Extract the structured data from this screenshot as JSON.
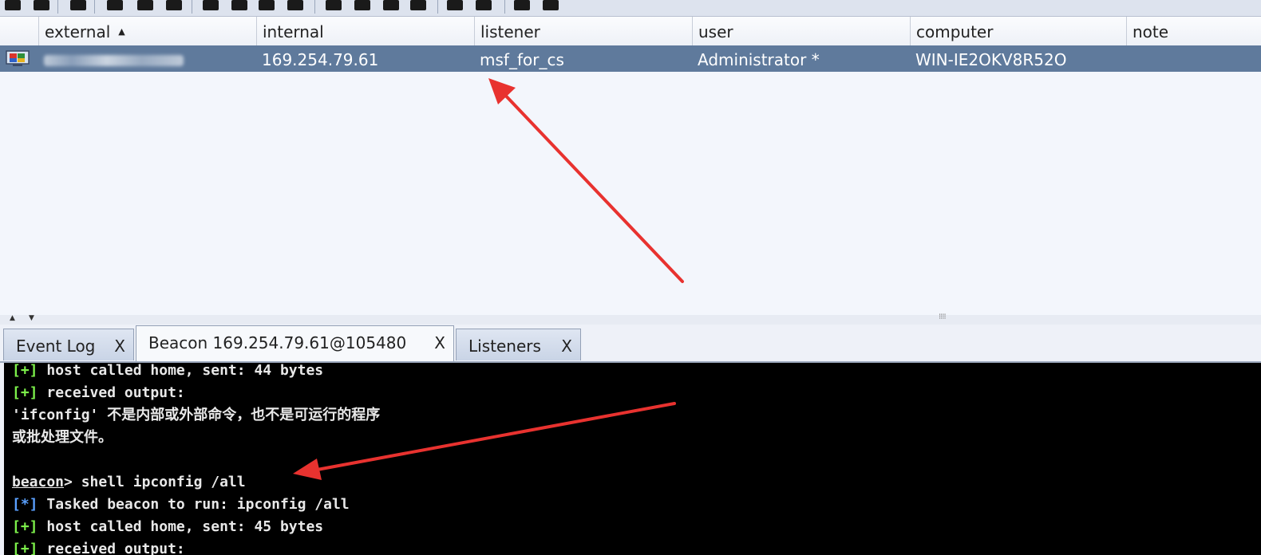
{
  "table": {
    "columns": [
      "external",
      "internal",
      "listener",
      "user",
      "computer",
      "note"
    ],
    "sort_indicator": "▲",
    "row": {
      "internal": "169.254.79.61",
      "listener": "msf_for_cs",
      "user": "Administrator *",
      "computer": "WIN-IE2OKV8R52O",
      "note": ""
    }
  },
  "divider": {
    "up": "▲",
    "down": "▼",
    "grip": "⁝⁝⁝⁝"
  },
  "tabs": [
    {
      "label": "Event Log",
      "close": "X"
    },
    {
      "label": "Beacon 169.254.79.61@105480",
      "close": "X"
    },
    {
      "label": "Listeners",
      "close": "X"
    }
  ],
  "console": {
    "l1": {
      "tag": "[+]",
      "text": " host called home, sent: 44 bytes"
    },
    "l2": {
      "tag": "[+]",
      "text": " received output:"
    },
    "l3": "'ifconfig' 不是内部或外部命令，也不是可运行的程序",
    "l4": "或批处理文件。",
    "l5": {
      "prompt": "beacon",
      "text": "> shell ipconfig /all"
    },
    "l6": {
      "tag": "[*]",
      "text": " Tasked beacon to run: ipconfig /all"
    },
    "l7": {
      "tag": "[+]",
      "text": " host called home, sent: 45 bytes"
    },
    "l8": {
      "tag": "[+]",
      "text": " received output:"
    }
  },
  "colors": {
    "selected_row": "#5f7a9c",
    "console_bg": "#000000",
    "arrow": "#e8322f",
    "ok_tag": "#7cf04a",
    "task_tag": "#5aa0ff"
  }
}
